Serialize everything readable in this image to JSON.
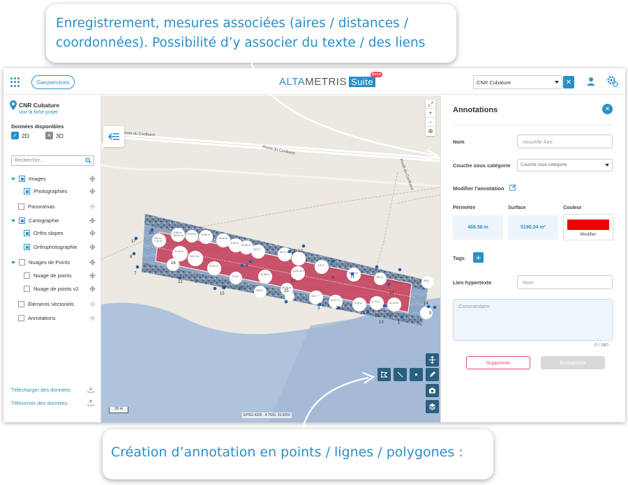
{
  "callouts": {
    "top": "Enregistrement, mesures associées (aires / distances / coordonnées). Possibilité d’y associer du texte / des liens",
    "bottom": "Création d’annotation en points / lignes / polygones :"
  },
  "topbar": {
    "geoservices_label": "Geoservices",
    "logo_part1": "ALTA",
    "logo_part2": "METRIS",
    "logo_suite": "Suite",
    "logo_badge": "Beta",
    "project_select_value": "CNR Cubature",
    "clear_label": "✕"
  },
  "sidebar": {
    "project_name": "CNR Cubature",
    "project_link": "Voir la fiche projet",
    "data_title": "Données disponibles",
    "mode_2d": "2D",
    "mode_3d": "3D",
    "search_placeholder": "Rechercher...",
    "layers": [
      {
        "label": "Images"
      },
      {
        "label": "Photographies"
      },
      {
        "label": "Panoramas"
      },
      {
        "label": "Cartographie"
      },
      {
        "label": "Ortho slopes"
      },
      {
        "label": "Orthophotographie"
      },
      {
        "label": "Nuages de Points"
      },
      {
        "label": "Nuage de points"
      },
      {
        "label": "Nuage de points v2"
      },
      {
        "label": "Éléments Vectoriels"
      },
      {
        "label": "Annotations"
      }
    ],
    "download_label": "Télécharger des données",
    "upload_label": "Téléverser des données"
  },
  "map": {
    "road_label_1": "Route du Confluent",
    "road_label_2": "Route du Confluent",
    "road_label_3": "Route du Confluent",
    "scale_label": "20 m",
    "coords_label": "EPSG:4326 : 4.7530, 43.9250",
    "markers": [
      "30",
      "17",
      "8",
      "7",
      "22",
      "2",
      "16",
      "15",
      "26",
      "20",
      "6",
      "5",
      "12",
      "4",
      "11",
      "3",
      "25",
      "23",
      "19",
      "24",
      "10",
      "1",
      "14",
      "9",
      "13",
      "21",
      "27"
    ]
  },
  "panel": {
    "title": "Annotations",
    "name_label": "Nom",
    "name_placeholder": "nouvelle Aire",
    "category_label": "Couche sous catégorie",
    "category_value": "Couche sous catégorie",
    "edit_label": "Modifier l'annotation",
    "perimeter_label": "Périmètre",
    "perimeter_value": "468.58 m",
    "surface_label": "Surface",
    "surface_value": "5190.34 m²",
    "color_label": "Couleur",
    "color_value": "#f00000",
    "color_modify": "Modifier",
    "tags_label": "Tags",
    "link_label": "Lien hypertexte",
    "link_placeholder": "Nom",
    "comment_placeholder": "Commentaire",
    "counter": "0 / 280",
    "delete_label": "Supprimer",
    "save_label": "Enregistrer"
  }
}
